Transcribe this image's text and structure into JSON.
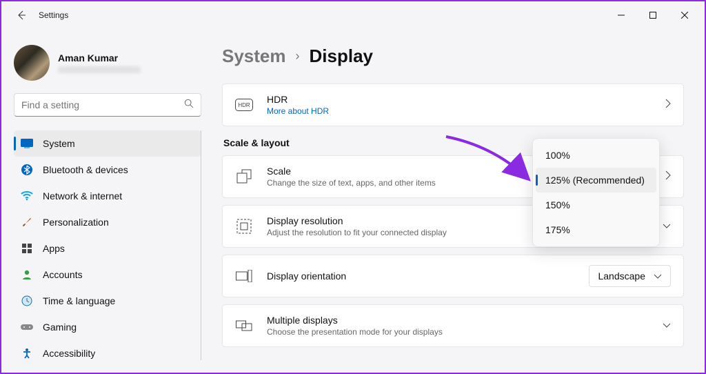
{
  "app": {
    "title": "Settings"
  },
  "profile": {
    "name": "Aman Kumar"
  },
  "search": {
    "placeholder": "Find a setting"
  },
  "nav": {
    "items": [
      {
        "label": "System"
      },
      {
        "label": "Bluetooth & devices"
      },
      {
        "label": "Network & internet"
      },
      {
        "label": "Personalization"
      },
      {
        "label": "Apps"
      },
      {
        "label": "Accounts"
      },
      {
        "label": "Time & language"
      },
      {
        "label": "Gaming"
      },
      {
        "label": "Accessibility"
      }
    ]
  },
  "breadcrumb": {
    "parent": "System",
    "leaf": "Display"
  },
  "hdr": {
    "title": "HDR",
    "link": "More about HDR"
  },
  "section": {
    "scale_layout": "Scale & layout"
  },
  "cards": {
    "scale": {
      "title": "Scale",
      "sub": "Change the size of text, apps, and other items"
    },
    "resolution": {
      "title": "Display resolution",
      "sub": "Adjust the resolution to fit your connected display"
    },
    "orientation": {
      "title": "Display orientation",
      "value": "Landscape"
    },
    "multiple": {
      "title": "Multiple displays",
      "sub": "Choose the presentation mode for your displays"
    }
  },
  "scale_dropdown": {
    "options": [
      "100%",
      "125% (Recommended)",
      "150%",
      "175%"
    ],
    "selected_index": 1
  }
}
